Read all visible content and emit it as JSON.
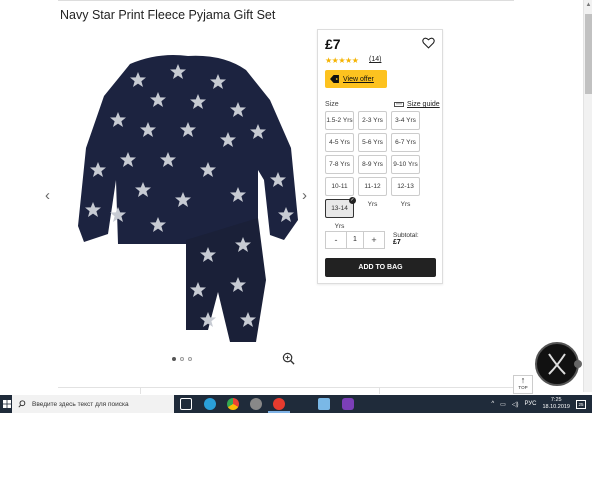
{
  "product": {
    "title": "Navy Star Print Fleece Pyjama Gift Set",
    "price": "£7",
    "rating_stars": "★★★★★",
    "rating_value": 5,
    "reviews": "(14)",
    "offer_label": "View offer",
    "size_label": "Size",
    "size_guide_label": "Size guide",
    "sizes": [
      "1.5-2 Yrs",
      "2-3 Yrs",
      "3-4 Yrs",
      "4-5 Yrs",
      "5-6 Yrs",
      "6-7 Yrs",
      "7-8 Yrs",
      "8-9 Yrs",
      "9-10 Yrs",
      "10-11 Yrs",
      "11-12 Yrs",
      "12-13 Yrs",
      "13-14 Yrs"
    ],
    "selected_size": "13-14 Yrs",
    "quantity": "1",
    "qty_minus": "-",
    "qty_plus": "+",
    "subtotal_label": "Subtotal:",
    "subtotal_value": "£7",
    "add_to_bag": "ADD TO BAG",
    "image_page": 1,
    "image_count": 3
  },
  "page": {
    "to_top_label": "TOP"
  },
  "taskbar": {
    "search_placeholder": "Введите здесь текст для поиска",
    "language": "РУС",
    "time": "7:25",
    "date": "18.10.2019",
    "notifications": "25"
  },
  "colors": {
    "accent_offer": "#fdc21f",
    "stars": "#f5b301",
    "taskbar": "#1f2b3a",
    "pyjama_navy": "#1c2340"
  }
}
